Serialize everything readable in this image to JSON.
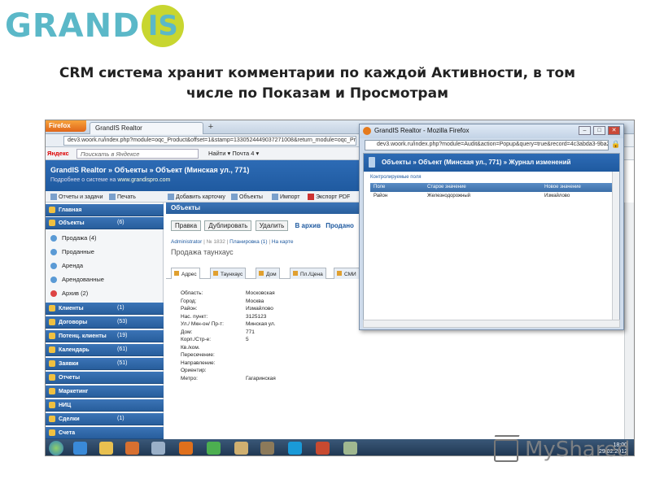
{
  "logo": {
    "text_main": "GRAND",
    "text_circle": "IS",
    "color_text": "#5bb8c8",
    "color_circle": "#c8d630"
  },
  "headline": {
    "line1": "CRM система хранит комментарии по каждой Активности, в том",
    "line2": "числе по Показам и Просмотрам"
  },
  "browser": {
    "firefox_label": "Firefox",
    "tab_title": "GrandIS Realtor",
    "tab_plus": "+",
    "url": "dev3.woork.ru/index.php?module=oqc_Product&offset=1&stamp=1330524449037271008&return_module=oqc_Product&acti",
    "yandex_label": "Яндекс",
    "yandex_search": "Поискать в Яндексе",
    "yandex_menu": "Найти ▾   Почта 4 ▾"
  },
  "app": {
    "breadcrumb": "GrandIS Realtor » Объекты » Объект (Минская ул., 771)",
    "about_prefix": "Подробнее о системе на ",
    "about_link": "www.grandispro.com",
    "toolbar": {
      "reports": "Отчеты и задачи",
      "print": "Печать",
      "add_card": "Добавить карточку",
      "objects": "Объекты",
      "import": "Импорт",
      "export": "Экспорт PDF"
    }
  },
  "sidebar": {
    "main": "Главная",
    "objects": {
      "label": "Объекты",
      "count": "(6)"
    },
    "subs": [
      {
        "label": "Продажа (4)",
        "icon": "sale-icon"
      },
      {
        "label": "Проданные",
        "icon": "sold-icon"
      },
      {
        "label": "Аренда",
        "icon": "rent-icon"
      },
      {
        "label": "Арендованные",
        "icon": "rented-icon"
      },
      {
        "label": "Архив (2)",
        "icon": "archive-icon"
      }
    ],
    "sections": [
      {
        "label": "Клиенты",
        "count": "(1)"
      },
      {
        "label": "Договоры",
        "count": "(53)"
      },
      {
        "label": "Потенц. клиенты",
        "count": "(19)"
      },
      {
        "label": "Календарь",
        "count": "(61)"
      },
      {
        "label": "Заявки",
        "count": "(51)"
      },
      {
        "label": "Отчеты",
        "count": ""
      },
      {
        "label": "Маркетинг",
        "count": ""
      },
      {
        "label": "НИЦ",
        "count": ""
      },
      {
        "label": "Сделки",
        "count": "(1)"
      },
      {
        "label": "Счета",
        "count": ""
      }
    ]
  },
  "main": {
    "title": "Объекты",
    "buttons": {
      "edit": "Правка",
      "duplicate": "Дублировать",
      "delete": "Удалить"
    },
    "links": {
      "archive": "В архив",
      "sold": "Продано"
    },
    "info": {
      "user": "Administrator",
      "num": "№ 1832",
      "plan": "Планировка (1)",
      "map": "На карте"
    },
    "subtitle": "Продажа таунхаус",
    "tabs": [
      "Адрес",
      "Таунхаус",
      "Дом",
      "Пл./Цена",
      "СМИ"
    ],
    "fields": [
      {
        "label": "Область:",
        "value": "Московская"
      },
      {
        "label": "Город:",
        "value": "Москва"
      },
      {
        "label": "Район:",
        "value": "Измайлово"
      },
      {
        "label": "Нас. пункт:",
        "value": "3125123"
      },
      {
        "label": "Ул./ Мкн-он/ Пр-т:",
        "value": "Минская ул."
      },
      {
        "label": "Дом:",
        "value": "771"
      },
      {
        "label": "Корп./Стр-е:",
        "value": "5"
      },
      {
        "label": "Кв./ком.",
        "value": ""
      },
      {
        "label": "Пересечение:",
        "value": ""
      },
      {
        "label": "Направление:",
        "value": ""
      },
      {
        "label": "Ориентир:",
        "value": ""
      },
      {
        "label": "Метро:",
        "value": "Гагаринская"
      }
    ]
  },
  "taskbar": {
    "clock_time": "18:00",
    "clock_date": "29.02.2012"
  },
  "popup": {
    "title": "GrandIS Realtor - Mozilla Firefox",
    "btn_min": "–",
    "btn_max": "□",
    "btn_close": "✕",
    "url": "dev3.woork.ru/index.php?module=Audit&action=Popup&query=true&record=4c3abda3-9ba2-",
    "lock": "🔒",
    "header": "Объекты  »  Объект (Минская ул., 771)  »  Журнал изменений",
    "subtitle": "Контролируемые поля",
    "columns": [
      "Поле",
      "Старое значение",
      "Новое значение"
    ],
    "rows": [
      [
        "Район",
        "Железнодорожный",
        "Измайлово"
      ]
    ]
  },
  "watermark": {
    "text": "MyShared"
  }
}
